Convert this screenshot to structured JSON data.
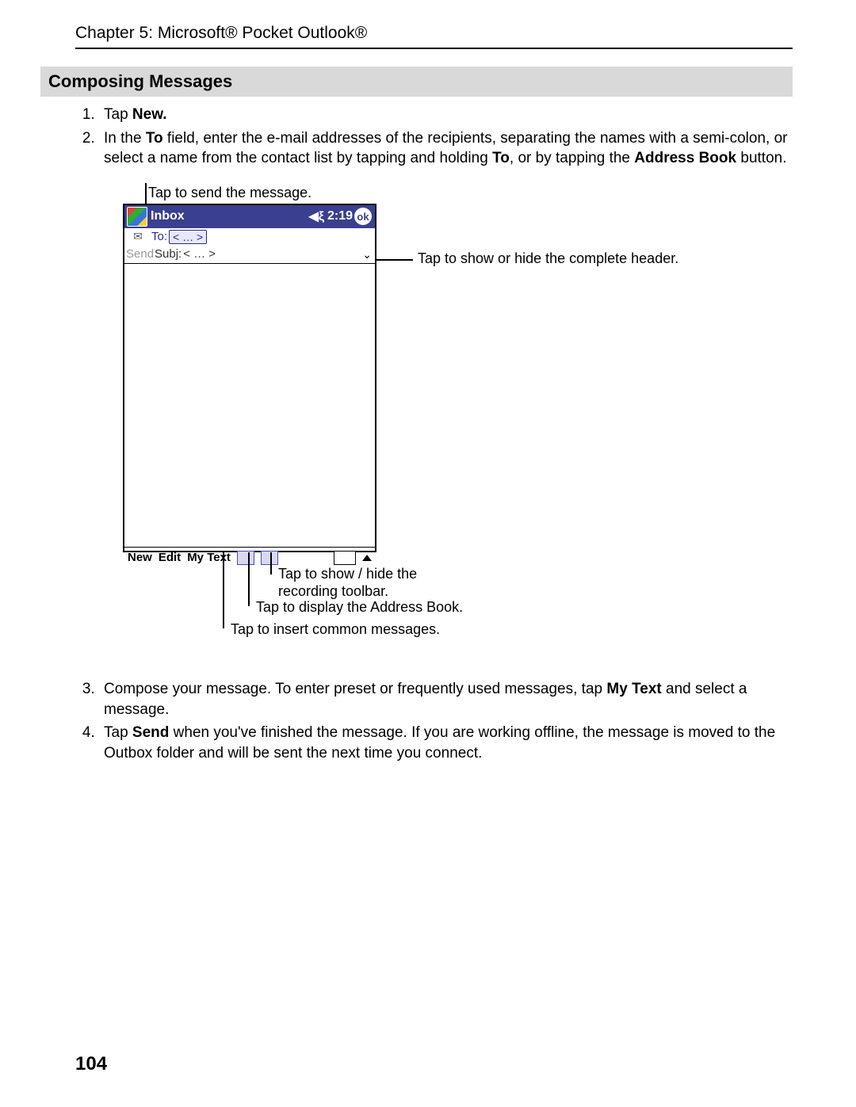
{
  "header": {
    "chapter_line": "Chapter 5: Microsoft® Pocket Outlook®"
  },
  "section": {
    "title": "Composing Messages"
  },
  "steps": {
    "s1": {
      "prefix": "Tap ",
      "bold": "New."
    },
    "s2": {
      "p1": "In the ",
      "b1": "To",
      "p2": " field, enter the e-mail addresses of the recipients, separating the names with a semi-colon, or select a name from the contact list by tapping and holding ",
      "b2": "To",
      "p3": ", or by tapping the ",
      "b3": "Address Book",
      "p4": " button."
    },
    "s3": {
      "p1": "Compose your message. To enter preset or frequently used messages, tap ",
      "b1": "My Text",
      "p2": " and select a message."
    },
    "s4": {
      "p1": "Tap ",
      "b1": "Send",
      "p2": " when you've finished the message. If you are working offline, the message is moved to the Outbox folder and will be sent the next time you connect."
    }
  },
  "figure": {
    "callouts": {
      "top": "Tap to send the message.",
      "right": "Tap to show or hide the complete header.",
      "b1": "Tap to show / hide the recording toolbar.",
      "b2": "Tap to display the Address Book.",
      "b3": "Tap to insert common messages."
    },
    "device": {
      "app_title": "Inbox",
      "time": "2:19",
      "ok": "ok",
      "to_label": "To:",
      "to_value": "< … >",
      "subj_label": "Subj:",
      "subj_value": "< … >",
      "send": "Send",
      "menu_new": "New",
      "menu_edit": "Edit",
      "menu_mytext": "My Text"
    }
  },
  "page_number": "104"
}
